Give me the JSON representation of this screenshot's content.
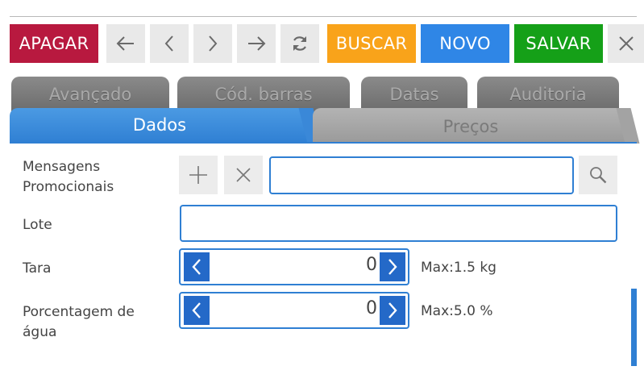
{
  "toolbar": {
    "delete_label": "APAGAR",
    "search_label": "BUSCAR",
    "new_label": "NOVO",
    "save_label": "SALVAR"
  },
  "tabs": {
    "back": [
      "Avançado",
      "Cód. barras",
      "Datas",
      "Auditoria"
    ],
    "front": [
      "Dados",
      "Preços"
    ]
  },
  "form": {
    "mensagens": {
      "label_line1": "Mensagens",
      "label_line2": "Promocionais",
      "value": ""
    },
    "lote": {
      "label": "Lote",
      "value": ""
    },
    "tara": {
      "label": "Tara",
      "value": "0",
      "max": "Max:1.5 kg"
    },
    "agua": {
      "label_line1": "Porcentagem de",
      "label_line2": "água",
      "value": "0",
      "max": "Max:5.0 %"
    }
  },
  "colors": {
    "delete": "#b8193f",
    "search": "#f9a31a",
    "new": "#2f86e6",
    "save": "#15a018",
    "accent": "#2f7fd3"
  }
}
